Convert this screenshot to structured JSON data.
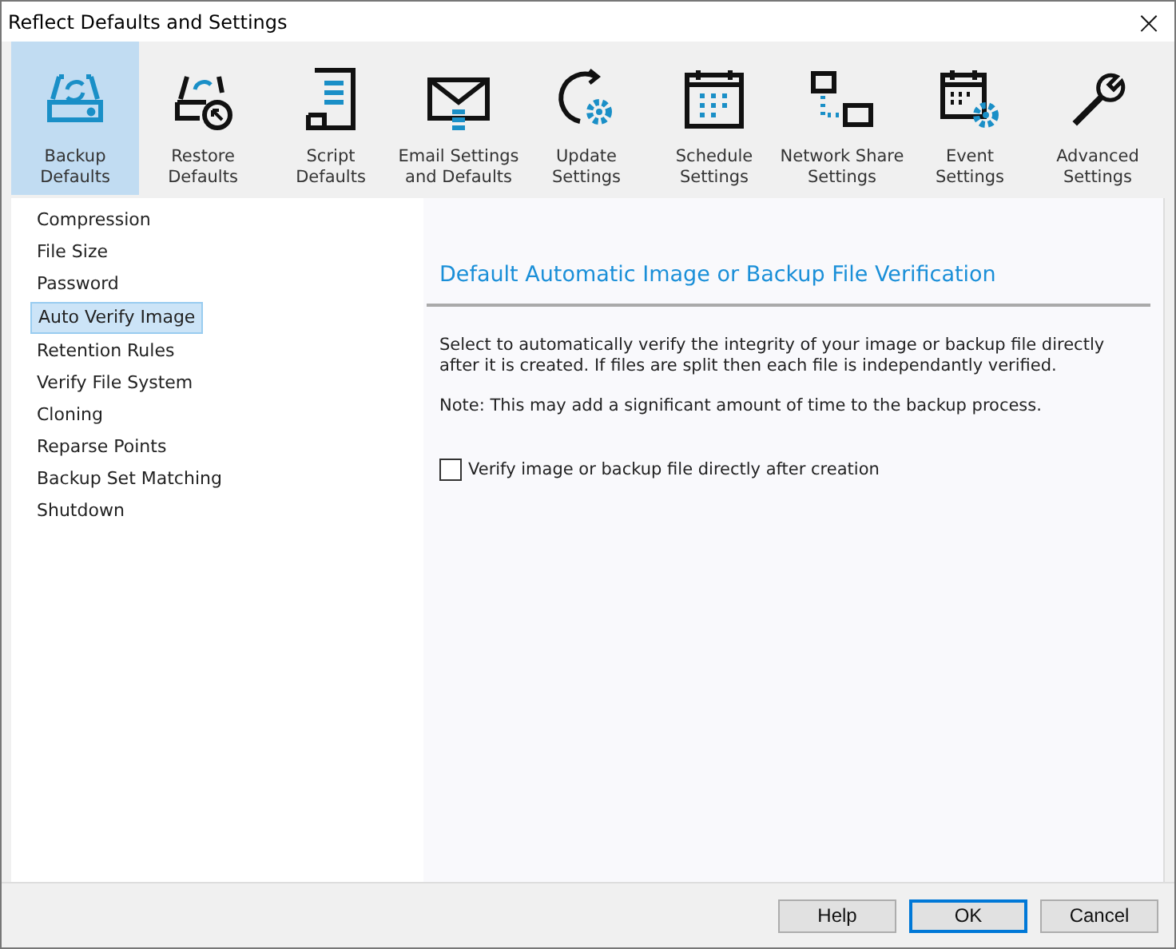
{
  "window": {
    "title": "Reflect Defaults and Settings",
    "close": "×"
  },
  "toolbar": [
    {
      "label": "Backup\nDefaults",
      "selected": true
    },
    {
      "label": "Restore\nDefaults",
      "selected": false
    },
    {
      "label": "Script\nDefaults",
      "selected": false
    },
    {
      "label": "Email Settings\nand Defaults",
      "selected": false
    },
    {
      "label": "Update\nSettings",
      "selected": false
    },
    {
      "label": "Schedule\nSettings",
      "selected": false
    },
    {
      "label": "Network Share\nSettings",
      "selected": false
    },
    {
      "label": "Event\nSettings",
      "selected": false
    },
    {
      "label": "Advanced\nSettings",
      "selected": false
    }
  ],
  "sidebar": {
    "items": [
      {
        "label": "Compression",
        "selected": false
      },
      {
        "label": "File Size",
        "selected": false
      },
      {
        "label": "Password",
        "selected": false
      },
      {
        "label": "Auto Verify Image",
        "selected": true
      },
      {
        "label": "Retention Rules",
        "selected": false
      },
      {
        "label": "Verify File System",
        "selected": false
      },
      {
        "label": "Cloning",
        "selected": false
      },
      {
        "label": "Reparse Points",
        "selected": false
      },
      {
        "label": "Backup Set Matching",
        "selected": false
      },
      {
        "label": "Shutdown",
        "selected": false
      }
    ]
  },
  "panel": {
    "heading": "Default Automatic Image or Backup File Verification",
    "description": "Select to automatically verify the integrity of your image or backup file directly after it is created. If files are split then each file is independantly verified.",
    "note": "Note: This may add a significant amount of time to the backup process.",
    "checkbox": {
      "label": "Verify image or backup file directly after creation",
      "checked": false
    }
  },
  "buttons": [
    {
      "label": "Help",
      "selected": false
    },
    {
      "label": "OK",
      "selected": true
    },
    {
      "label": "Cancel",
      "selected": false
    }
  ]
}
